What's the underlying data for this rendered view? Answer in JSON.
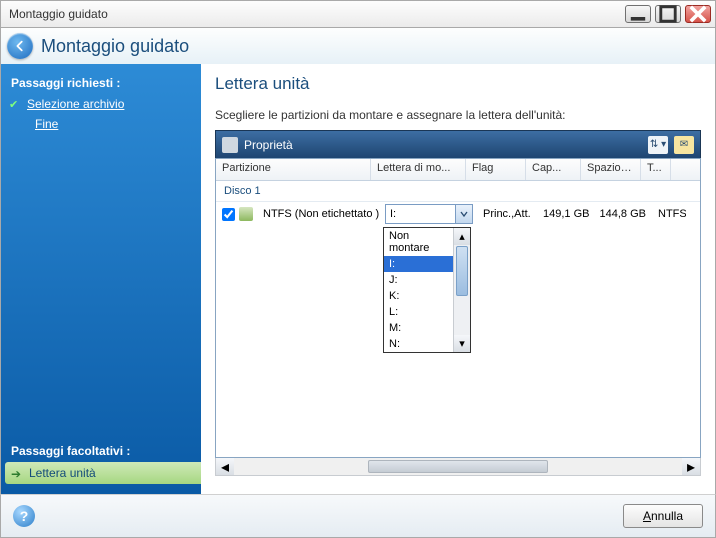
{
  "window": {
    "title": "Montaggio guidato"
  },
  "header": {
    "title": "Montaggio guidato"
  },
  "sidebar": {
    "required_title": "Passaggi richiesti :",
    "optional_title": "Passaggi facoltativi :",
    "steps": [
      {
        "label": "Selezione archivio",
        "done": true
      },
      {
        "label": "Fine",
        "done": false
      }
    ],
    "active": {
      "label": "Lettera unità"
    }
  },
  "main": {
    "title": "Lettera unità",
    "instruction": "Scegliere le partizioni da montare e assegnare la lettera dell'unità:",
    "toolbar": {
      "properties": "Proprietà"
    },
    "columns": {
      "partition": "Partizione",
      "letter": "Lettera di mo...",
      "flag": "Flag",
      "capacity": "Cap...",
      "free": "Spazio l...",
      "type": "T..."
    },
    "group": "Disco 1",
    "row": {
      "checked": true,
      "name": "NTFS (Non etichettato ) (C:)",
      "letter_selected": "I:",
      "flag": "Princ.,Att.",
      "capacity": "149,1 GB",
      "free": "144,8 GB",
      "type": "NTFS"
    },
    "dropdown": {
      "options": [
        "Non montare",
        "I:",
        "J:",
        "K:",
        "L:",
        "M:",
        "N:"
      ],
      "selected": "I:"
    }
  },
  "footer": {
    "cancel": "Annulla",
    "cancel_key": "A"
  }
}
